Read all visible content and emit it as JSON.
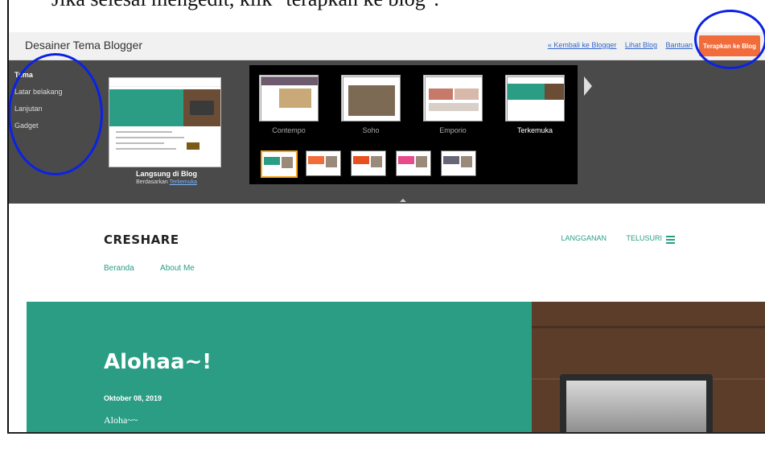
{
  "caption": "Jika selesai mengedit, klik \"terapkan ke blog\".",
  "topbar": {
    "title": "Desainer Tema Blogger",
    "links": [
      "« Kembali ke Blogger",
      "Lihat Blog",
      "Bantuan"
    ],
    "apply_button": "Terapkan ke Blog"
  },
  "sidebar": {
    "items": [
      {
        "label": "Tema",
        "active": true
      },
      {
        "label": "Latar belakang",
        "active": false
      },
      {
        "label": "Lanjutan",
        "active": false
      },
      {
        "label": "Gadget",
        "active": false
      }
    ]
  },
  "preview": {
    "label": "Langsung di Blog",
    "sub_prefix": "Berdasarkan",
    "sub_link": "Terkemuka"
  },
  "themes": [
    {
      "name": "Contempo",
      "selected": false
    },
    {
      "name": "Soho",
      "selected": false
    },
    {
      "name": "Emporio",
      "selected": false
    },
    {
      "name": "Terkemuka",
      "selected": true
    }
  ],
  "variants": [
    {
      "color": "#2a9d84",
      "selected": true
    },
    {
      "color": "#f26b3a",
      "selected": false
    },
    {
      "color": "#e8501f",
      "selected": false
    },
    {
      "color": "#e84a8a",
      "selected": false
    },
    {
      "color": "#666677",
      "selected": false
    }
  ],
  "blog": {
    "brand": "CRESHARE",
    "nav": [
      "LANGGANAN",
      "TELUSURI"
    ],
    "sub_nav": [
      "Beranda",
      "About Me"
    ],
    "post_title": "Alohaa~!",
    "post_date": "Oktober 08, 2019",
    "post_snippet": "Aloha~~"
  },
  "colors": {
    "accent": "#2a9d84",
    "apply_button": "#f26b3a",
    "annotation": "#0b22e6"
  }
}
